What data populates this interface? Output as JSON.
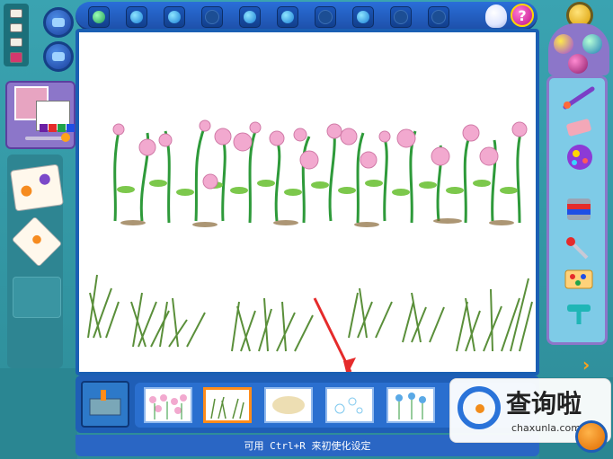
{
  "app": {
    "status_text": "可用 Ctrl+R 来初使化设定",
    "help_label": "?"
  },
  "toolbar": {
    "buttons": [
      {
        "name": "tool-1",
        "state": "green"
      },
      {
        "name": "tool-2",
        "state": "active"
      },
      {
        "name": "tool-3",
        "state": "active"
      },
      {
        "name": "tool-4",
        "state": "dim"
      },
      {
        "name": "tool-5",
        "state": "active"
      },
      {
        "name": "tool-6",
        "state": "active"
      },
      {
        "name": "tool-7",
        "state": "dim"
      },
      {
        "name": "tool-8",
        "state": "active"
      },
      {
        "name": "tool-9",
        "state": "dim"
      },
      {
        "name": "tool-10",
        "state": "dim"
      }
    ]
  },
  "right_tools": [
    {
      "name": "paintbrush-icon"
    },
    {
      "name": "eraser-icon"
    },
    {
      "name": "spray-can-icon"
    },
    {
      "name": "paint-bucket-icon"
    },
    {
      "name": "dropper-icon"
    },
    {
      "name": "stamp-tray-icon"
    },
    {
      "name": "roller-icon"
    }
  ],
  "bottom_tray": {
    "thumbnails": [
      {
        "name": "pink-flowers-stamp",
        "selected": false
      },
      {
        "name": "grass-stamp",
        "selected": true
      },
      {
        "name": "sand-stamp",
        "selected": false
      },
      {
        "name": "bubbles-stamp",
        "selected": false
      },
      {
        "name": "blue-flowers-stamp",
        "selected": false
      }
    ]
  },
  "watermark": {
    "brand": "查询啦",
    "url": "chaxunla.com"
  },
  "colors": {
    "toolbar_blue": "#1f5eb6",
    "panel_purple": "#8c76c9",
    "background_teal": "#2f8e9a",
    "accent_orange": "#ff8c1a",
    "annotation_red": "#e52b2b"
  }
}
